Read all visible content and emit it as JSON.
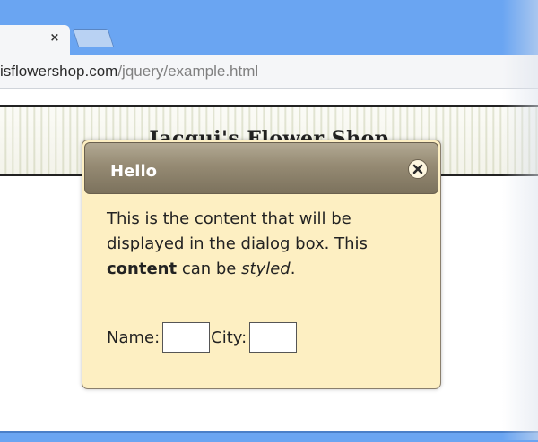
{
  "browser": {
    "tab_close_label": "×",
    "url_domain": "isflowershop.com",
    "url_path": "/jquery/example.html"
  },
  "page": {
    "banner_title": "Jacqui's Flower Shop"
  },
  "dialog": {
    "title": "Hello",
    "close_icon": "close-x-icon",
    "body_text_1": "This is the content that will be displayed in the dialog box. This",
    "body_bold": "content",
    "body_text_2": "can be",
    "body_italic": "styled",
    "body_text_3": ".",
    "name_label": "Name:",
    "name_value": "",
    "city_label": "City:",
    "city_value": ""
  },
  "colors": {
    "chrome_blue": "#6aa5f2",
    "dialog_bg": "#fdefc2",
    "titlebar": "#958a73"
  }
}
